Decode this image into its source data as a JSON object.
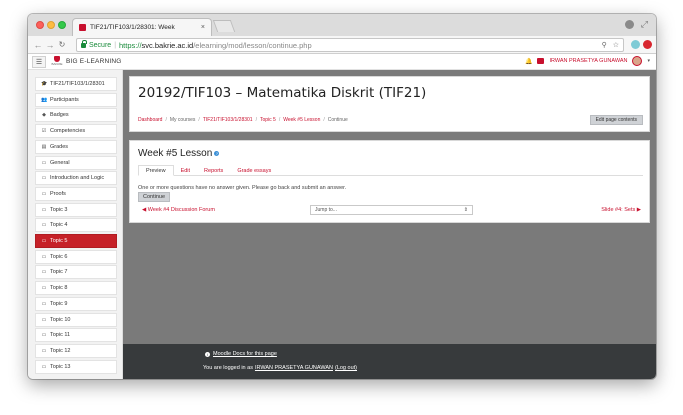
{
  "browser": {
    "tab_title": "TIF21/TIF103/1/28301: Week",
    "tab_close": "×",
    "secure_label": "Secure",
    "url_scheme": "https://",
    "url_host": "svc.bakrie.ac.id",
    "url_path": "/elearning/mod/lesson/continue.php"
  },
  "header": {
    "site_name": "BIG E-LEARNING",
    "logo_text": "BAKRIE",
    "user_name": "IRWAN PRASETYA GUNAWAN"
  },
  "sidebar": {
    "items": [
      {
        "label": "TIF21/TIF103/1/28301",
        "icon": "graduation-cap-icon",
        "glyph": "🎓"
      },
      {
        "label": "Participants",
        "icon": "users-icon",
        "glyph": "👥"
      },
      {
        "label": "Badges",
        "icon": "shield-icon",
        "glyph": "◆"
      },
      {
        "label": "Competencies",
        "icon": "checkbox-icon",
        "glyph": "☑"
      },
      {
        "label": "Grades",
        "icon": "table-icon",
        "glyph": "▤"
      },
      {
        "label": "General",
        "icon": "folder-icon",
        "glyph": "▭"
      },
      {
        "label": "Introduction and Logic",
        "icon": "folder-icon",
        "glyph": "▭"
      },
      {
        "label": "Proofs",
        "icon": "folder-icon",
        "glyph": "▭"
      },
      {
        "label": "Topic 3",
        "icon": "folder-icon",
        "glyph": "▭"
      },
      {
        "label": "Topic 4",
        "icon": "folder-icon",
        "glyph": "▭"
      },
      {
        "label": "Topic 5",
        "icon": "folder-icon",
        "glyph": "▭",
        "active": true
      },
      {
        "label": "Topic 6",
        "icon": "folder-icon",
        "glyph": "▭"
      },
      {
        "label": "Topic 7",
        "icon": "folder-icon",
        "glyph": "▭"
      },
      {
        "label": "Topic 8",
        "icon": "folder-icon",
        "glyph": "▭"
      },
      {
        "label": "Topic 9",
        "icon": "folder-icon",
        "glyph": "▭"
      },
      {
        "label": "Topic 10",
        "icon": "folder-icon",
        "glyph": "▭"
      },
      {
        "label": "Topic 11",
        "icon": "folder-icon",
        "glyph": "▭"
      },
      {
        "label": "Topic 12",
        "icon": "folder-icon",
        "glyph": "▭"
      },
      {
        "label": "Topic 13",
        "icon": "folder-icon",
        "glyph": "▭"
      }
    ]
  },
  "page": {
    "course_title": "20192/TIF103 – Matematika Diskrit (TIF21)",
    "breadcrumb": [
      "Dashboard",
      "My courses",
      "TIF21/TIF103/1/28301",
      "Topic 5",
      "Week #5 Lesson",
      "Continue"
    ],
    "edit_button": "Edit page contents"
  },
  "lesson": {
    "title": "Week #5 Lesson",
    "tabs": [
      "Preview",
      "Edit",
      "Reports",
      "Grade essays"
    ],
    "notice": "One or more questions have no answer given. Please go back and submit an answer.",
    "continue_button": "Continue",
    "prev_link": "◀ Week #4 Discussion Forum",
    "jump_placeholder": "Jump to...",
    "next_link": "Slide #4: Sets ▶"
  },
  "footer": {
    "docs_link": "Moodle Docs for this page",
    "logged_in_prefix": "You are logged in as",
    "logged_in_user": "IRWAN PRASETYA GUNAWAN",
    "logout": "(Log out)"
  },
  "colors": {
    "accent": "#c8102e",
    "active_sidebar": "#c62128",
    "content_bg": "#7a7a7a",
    "footer_bg": "#373a3c"
  }
}
